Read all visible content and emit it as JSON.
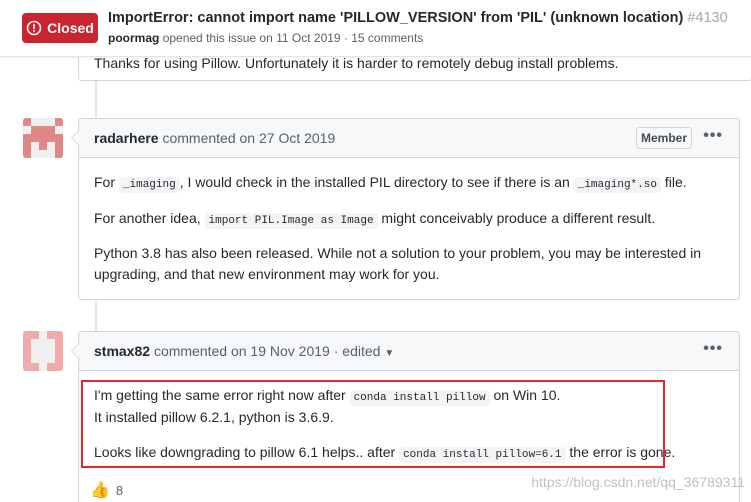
{
  "header": {
    "state": "Closed",
    "title": "ImportError: cannot import name 'PILLOW_VERSION' from 'PIL' (unknown location)",
    "number": "#4130",
    "author": "poormag",
    "meta_text": "opened this issue on 11 Oct 2019 · 15 comments"
  },
  "previous_comment": {
    "text": "Thanks for using Pillow. Unfortunately it is harder to remotely debug install problems."
  },
  "comments": [
    {
      "author": "radarhere",
      "action": "commented on 27 Oct 2019",
      "badge": "Member",
      "more": "•••",
      "p1_before": "For ",
      "p1_code1": "_imaging",
      "p1_mid": ", I would check in the installed PIL directory to see if there is an ",
      "p1_code2": "_imaging*.so",
      "p1_after": " file.",
      "p2_before": "For another idea, ",
      "p2_code": "import PIL.Image as Image",
      "p2_after": " might conceivably produce a different result.",
      "p3": "Python 3.8 has also been released. While not a solution to your problem, you may be interested in upgrading, and that new environment may work for you."
    },
    {
      "author": "stmax82",
      "action": "commented on 19 Nov 2019 ·",
      "edited": "edited",
      "more": "•••",
      "l1_before": "I'm getting the same error right now after ",
      "l1_code": "conda install pillow",
      "l1_after": " on Win 10.",
      "l2": "It installed pillow 6.2.1, python is 3.6.9.",
      "l3_before": "Looks like downgrading to pillow 6.1 helps.. after ",
      "l3_code": "conda install pillow=6.1",
      "l3_after": " the error is gone."
    }
  ],
  "reaction": {
    "icon": "thumbs-up-icon",
    "count": "8"
  },
  "watermark": "https://blog.csdn.net/qq_36789311",
  "colors": {
    "closed": "#cb2431",
    "highlight": "#e8262b",
    "avatar1": "#e08888",
    "avatar2": "#f0aaaa"
  }
}
